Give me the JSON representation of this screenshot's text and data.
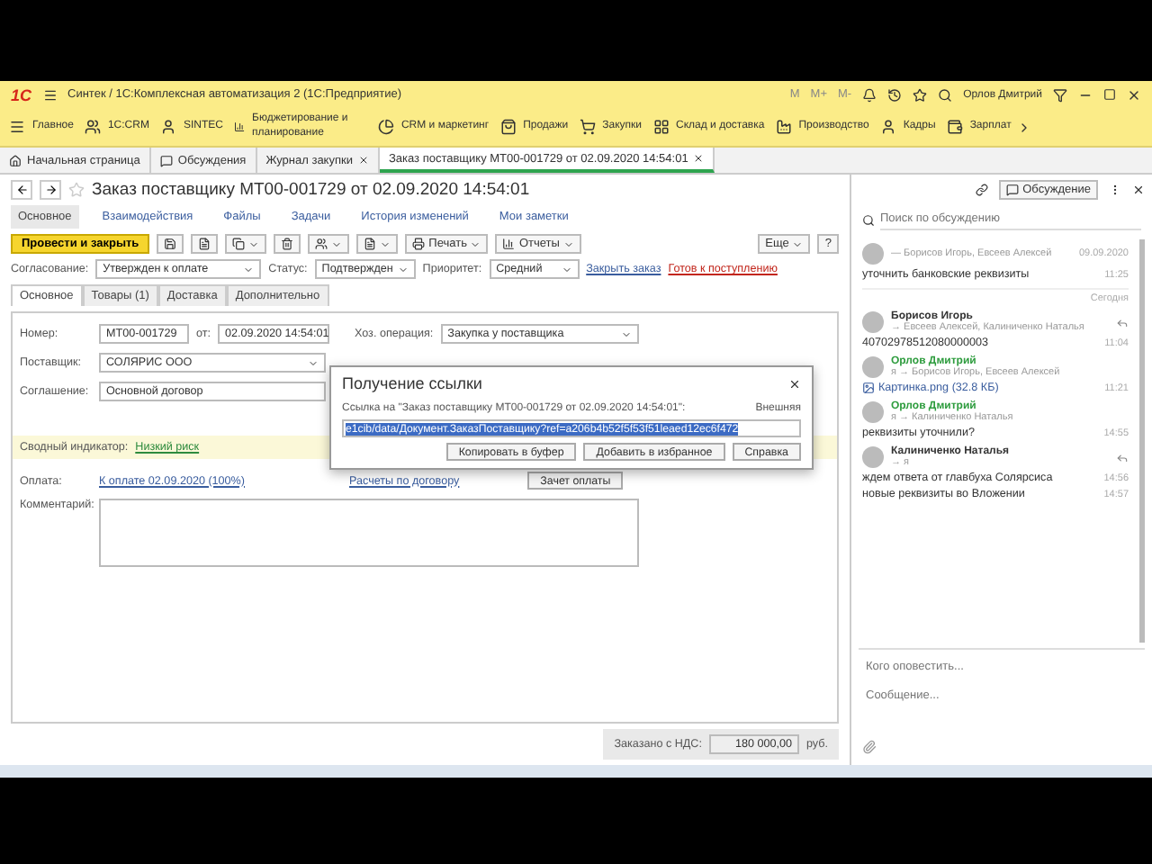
{
  "title_bar": {
    "logo": "1С",
    "title": "Синтек / 1С:Комплексная автоматизация 2  (1С:Предприятие)",
    "memory": [
      "M",
      "M+",
      "M-"
    ],
    "user": "Орлов Дмитрий"
  },
  "sections": [
    {
      "label": "Главное"
    },
    {
      "label": "1С:CRM"
    },
    {
      "label": "SINTEC"
    },
    {
      "label": "Бюджетирование и планирование"
    },
    {
      "label": "CRM и маркетинг"
    },
    {
      "label": "Продажи"
    },
    {
      "label": "Закупки"
    },
    {
      "label": "Склад и доставка"
    },
    {
      "label": "Производство"
    },
    {
      "label": "Кадры"
    },
    {
      "label": "Зарплат"
    }
  ],
  "open_tabs": [
    {
      "label": "Начальная страница",
      "closable": false,
      "selected": false
    },
    {
      "label": "Обсуждения",
      "closable": false,
      "selected": false
    },
    {
      "label": "Журнал закупки",
      "closable": true,
      "selected": false
    },
    {
      "label": "Заказ поставщику МТ00-001729 от 02.09.2020 14:54:01",
      "closable": true,
      "selected": true
    }
  ],
  "form": {
    "title": "Заказ поставщику МТ00-001729 от 02.09.2020 14:54:01",
    "links": [
      {
        "label": "Основное",
        "selected": true
      },
      {
        "label": "Взаимодействия",
        "selected": false
      },
      {
        "label": "Файлы",
        "selected": false
      },
      {
        "label": "Задачи",
        "selected": false
      },
      {
        "label": "История изменений",
        "selected": false
      },
      {
        "label": "Мои заметки",
        "selected": false
      }
    ],
    "toolbar": {
      "primary": "Провести и закрыть",
      "print": "Печать",
      "reports": "Отчеты",
      "more": "Еще",
      "help": "?"
    },
    "status_row": {
      "approval": {
        "label": "Согласование:",
        "value": "Утвержден к оплате"
      },
      "status": {
        "label": "Статус:",
        "value": "Подтвержден"
      },
      "priority": {
        "label": "Приоритет:",
        "value": "Средний"
      },
      "close_link": "Закрыть заказ",
      "state_link": "Готов к поступлению"
    },
    "tabs": [
      {
        "label": "Основное",
        "selected": true
      },
      {
        "label": "Товары (1)",
        "selected": false
      },
      {
        "label": "Доставка",
        "selected": false
      },
      {
        "label": "Дополнительно",
        "selected": false
      }
    ],
    "number": {
      "label": "Номер:",
      "value": "МТ00-001729"
    },
    "date": {
      "label": "от:",
      "value": "02.09.2020 14:54:01"
    },
    "operation": {
      "label": "Хоз. операция:",
      "value": "Закупка у поставщика"
    },
    "supplier": {
      "label": "Поставщик:",
      "value": "СОЛЯРИС ООО"
    },
    "agreement": {
      "label": "Соглашение:",
      "value": "Основной договор"
    },
    "indicator": {
      "label": "Сводный индикатор:",
      "value": "Низкий риск"
    },
    "payment": {
      "label": "Оплата:",
      "link": "К оплате 02.09.2020 (100%)",
      "settlements": "Расчеты по договору",
      "offset_button": "Зачет оплаты"
    },
    "comment": {
      "label": "Комментарий:"
    },
    "total": {
      "label": "Заказано с НДС:",
      "value": "180 000,00",
      "currency": "руб."
    }
  },
  "dialog": {
    "title": "Получение ссылки",
    "caption": "Ссылка на \"Заказ поставщику МТ00-001729 от 02.09.2020 14:54:01\":",
    "external": "Внешняя",
    "url": "e1cib/data/Документ.ЗаказПоставщику?ref=a206b4b52f5f53f51leaed12ec6f472",
    "buttons": [
      "Копировать в буфер",
      "Добавить в избранное",
      "Справка"
    ]
  },
  "discussion": {
    "button": "Обсуждение",
    "search_placeholder": "Поиск по обсуждению",
    "items": [
      {
        "kind": "message",
        "recipients": "— Борисов Игорь, Евсеев Алексей",
        "date": "09.09.2020",
        "lines": [
          {
            "kind": "text",
            "text": "уточнить банковские реквизиты",
            "time": "11:25"
          }
        ]
      },
      {
        "kind": "separator",
        "label": "Сегодня"
      },
      {
        "kind": "message",
        "author": "Борисов Игорь",
        "own": false,
        "recipients": "→ Евсеев Алексей, Калиниченко Наталья",
        "lines": [
          {
            "kind": "text",
            "text": "40702978512080000003",
            "time": "11:04"
          }
        ]
      },
      {
        "kind": "message",
        "author": "Орлов Дмитрий",
        "own": true,
        "recipients": "я → Борисов Игорь, Евсеев Алексей",
        "lines": [
          {
            "kind": "file",
            "text": "Картинка.png (32.8 КБ)",
            "time": "11:21"
          }
        ]
      },
      {
        "kind": "message",
        "author": "Орлов Дмитрий",
        "own": true,
        "recipients": "я → Калиниченко Наталья",
        "lines": [
          {
            "kind": "text",
            "text": "реквизиты уточнили?",
            "time": "14:55"
          }
        ]
      },
      {
        "kind": "message",
        "author": "Калиниченко Наталья",
        "own": false,
        "recipients": "→ я",
        "lines": [
          {
            "kind": "text",
            "text": "ждем ответа от главбуха Солярсиса",
            "time": "14:56"
          },
          {
            "kind": "text",
            "text": "новые реквизиты во Вложении",
            "time": "14:57"
          }
        ]
      }
    ],
    "notify_placeholder": "Кого оповестить...",
    "message_placeholder": "Сообщение..."
  }
}
